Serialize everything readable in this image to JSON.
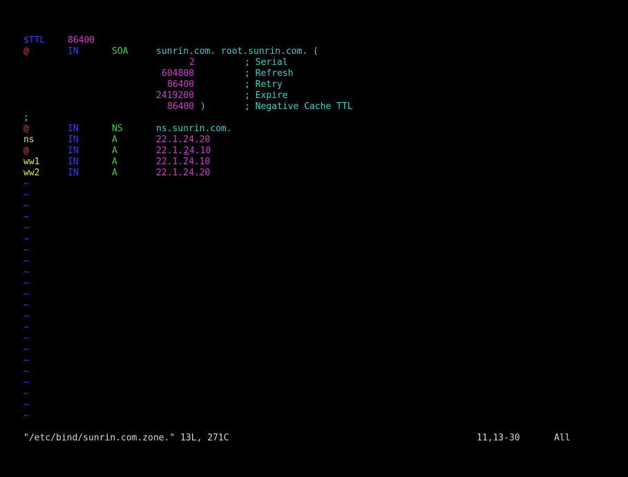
{
  "colors": {
    "background": "#000000",
    "keyword_blue": "#3b3bff",
    "number_magenta": "#d23cd2",
    "at_red": "#e03c3c",
    "type_green": "#3cd23c",
    "comment_cyan": "#3cd2d2",
    "host_yellow": "#e6e64a",
    "status_text": "#d8d8d8"
  },
  "lines": {
    "ttl": {
      "directive": "$TTL",
      "value": "86400"
    },
    "soa": {
      "name": "@",
      "class": "IN",
      "type": "SOA",
      "rdata": "sunrin.com. root.sunrin.com. ("
    },
    "serial": {
      "value": "2",
      "comment": "; Serial"
    },
    "refresh": {
      "value": "604800",
      "comment": "; Refresh"
    },
    "retry": {
      "value": "86400",
      "comment": "; Retry"
    },
    "expire": {
      "value": "2419200",
      "comment": "; Expire"
    },
    "negcache": {
      "value": "86400",
      "paren": ")",
      "comment": "; Negative Cache TTL"
    },
    "semicolon": ";",
    "rec_ns": {
      "name": "@",
      "class": "IN",
      "type": "NS",
      "rdata": "ns.sunrin.com."
    },
    "rec_a_ns": {
      "name": "ns",
      "class": "IN",
      "type": "A",
      "rdata": "22.1.24.20"
    },
    "rec_a_at": {
      "name": "@",
      "class": "IN",
      "type": "A",
      "rdata_pre": "22.1.",
      "rdata_cursor": "2",
      "rdata_post": "4.10"
    },
    "rec_a_ww1": {
      "name": "ww1",
      "class": "IN",
      "type": "A",
      "rdata": "22.1.24.10"
    },
    "rec_a_ww2": {
      "name": "ww2",
      "class": "IN",
      "type": "A",
      "rdata": "22.1.24.20"
    }
  },
  "tilde": "~",
  "status": {
    "file": "\"/etc/bind/sunrin.com.zone.\" 13L, 271C",
    "position": "11,13-30",
    "scroll": "All"
  }
}
